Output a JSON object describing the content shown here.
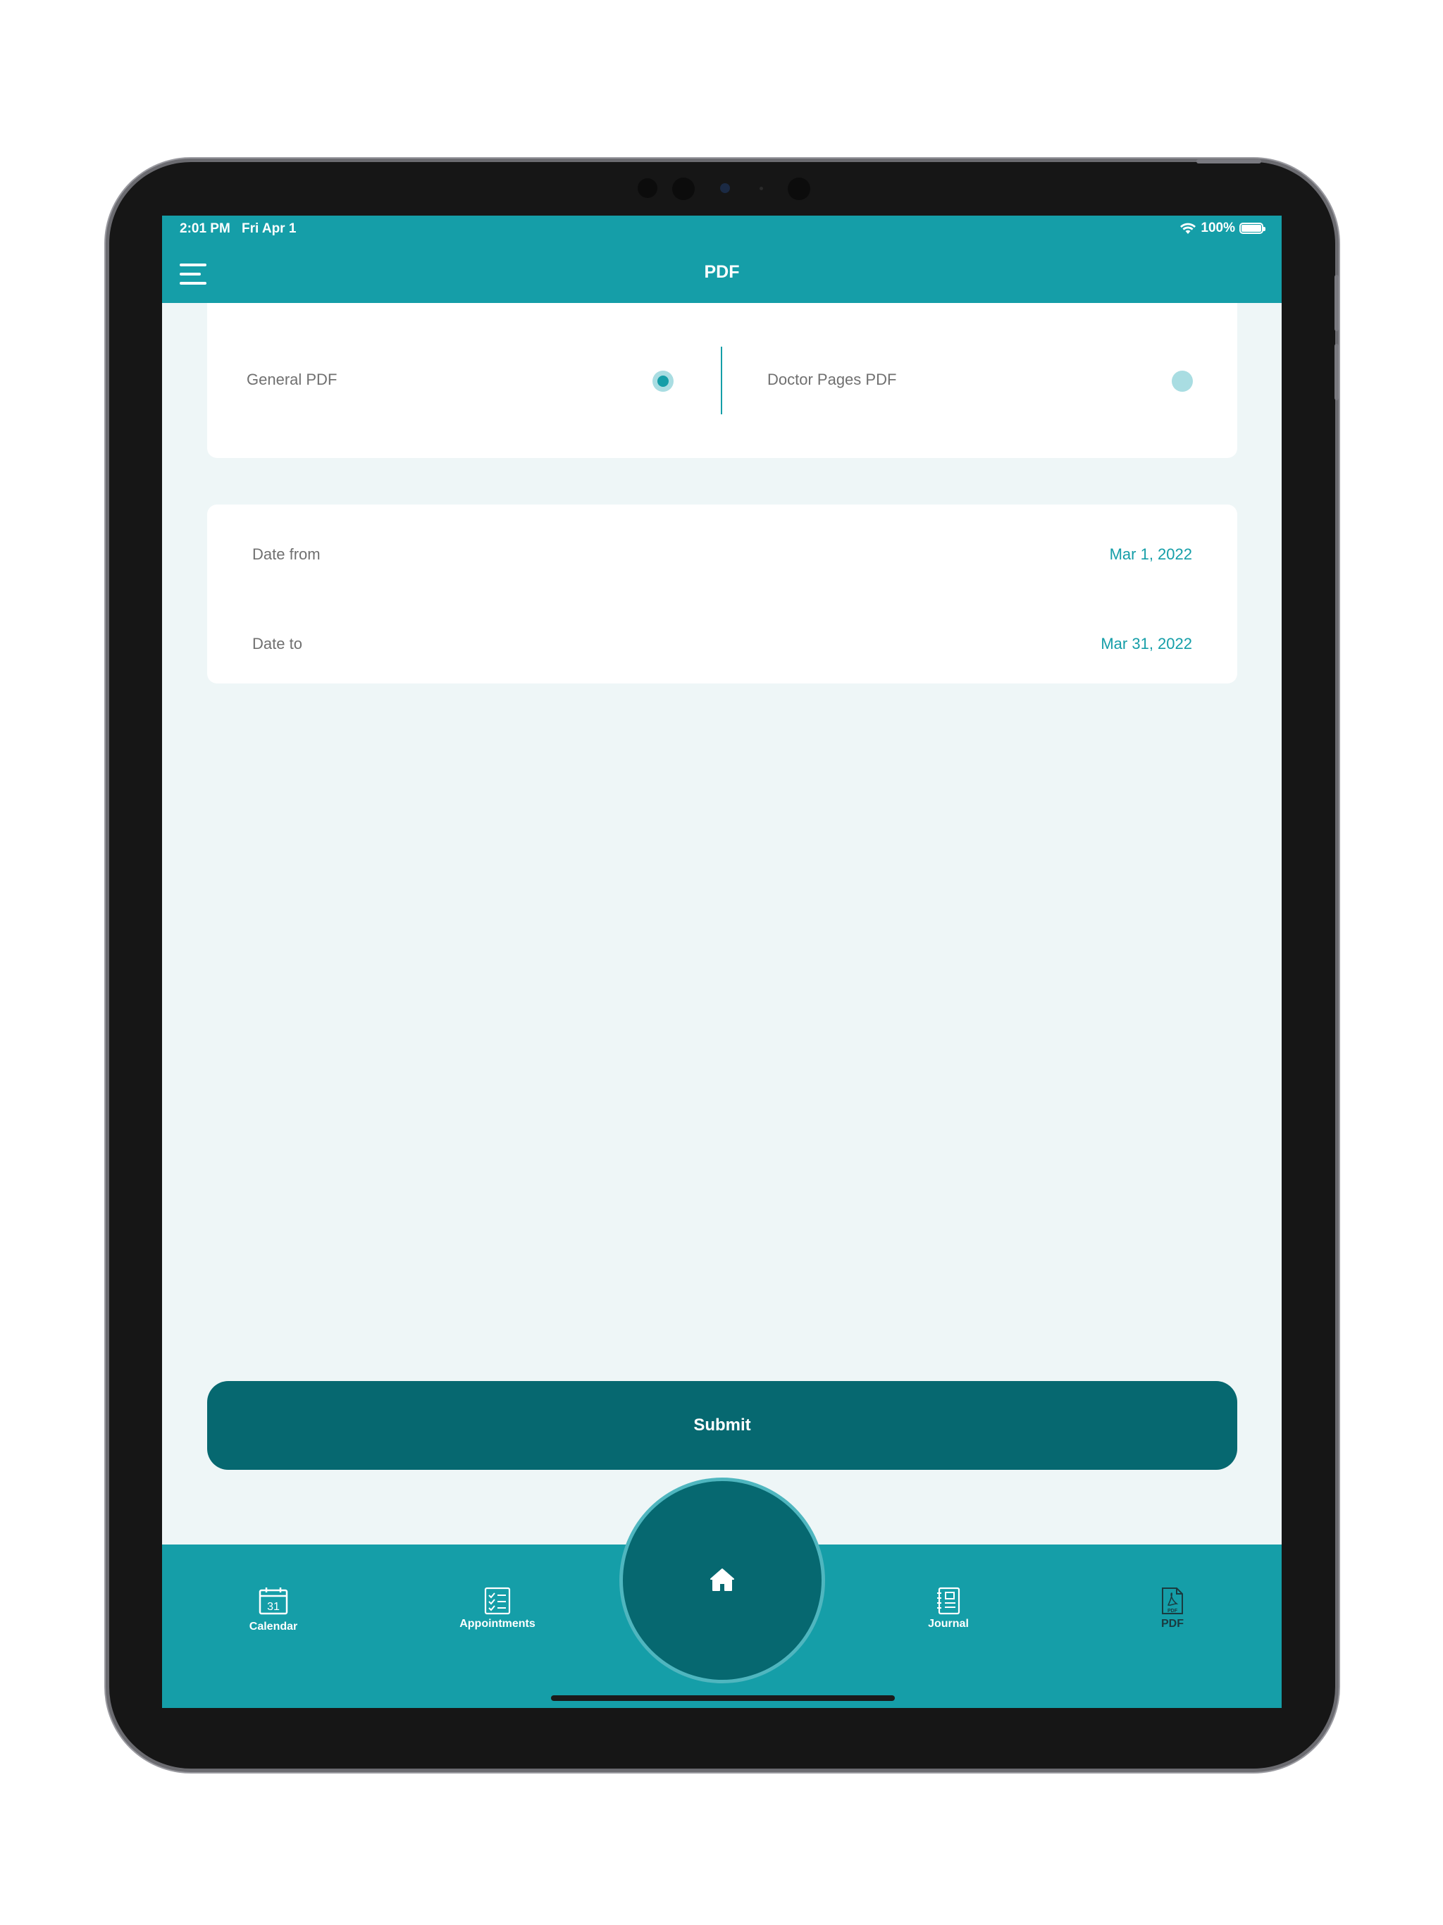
{
  "status_bar": {
    "time": "2:01 PM",
    "date": "Fri Apr 1",
    "battery": "100%"
  },
  "nav": {
    "title": "PDF"
  },
  "pdf_type": {
    "options": [
      {
        "label": "General PDF",
        "selected": true
      },
      {
        "label": "Doctor Pages PDF",
        "selected": false
      }
    ]
  },
  "dates": {
    "from_label": "Date from",
    "from_value": "Mar 1, 2022",
    "to_label": "Date to",
    "to_value": "Mar 31, 2022"
  },
  "actions": {
    "submit_label": "Submit"
  },
  "tabs": [
    {
      "label": "Calendar",
      "icon": "calendar-icon",
      "icon_text": "31"
    },
    {
      "label": "Appointments",
      "icon": "checklist-icon"
    },
    {
      "label": "Journal",
      "icon": "journal-icon"
    },
    {
      "label": "PDF",
      "icon": "pdf-file-icon",
      "icon_text": "PDF"
    }
  ],
  "colors": {
    "primary": "#159ea8",
    "dark": "#066870",
    "background": "#eef6f7",
    "text_muted": "#707070"
  }
}
